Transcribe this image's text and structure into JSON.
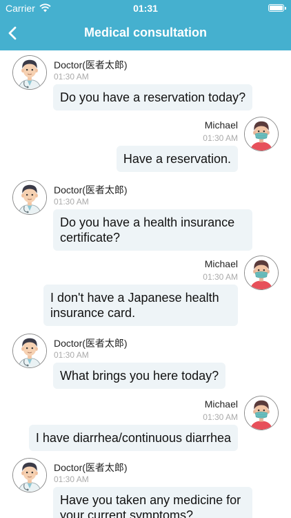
{
  "status_bar": {
    "carrier": "Carrier",
    "time": "01:31"
  },
  "nav": {
    "title": "Medical consultation"
  },
  "messages": [
    {
      "side": "left",
      "name": "Doctor(医者太郎)",
      "time": "01:30 AM",
      "text": "Do you have a reservation today?"
    },
    {
      "side": "right",
      "name": "Michael",
      "time": "01:30 AM",
      "text": "Have a reservation."
    },
    {
      "side": "left",
      "name": "Doctor(医者太郎)",
      "time": "01:30 AM",
      "text": "Do you have a health insurance certificate?"
    },
    {
      "side": "right",
      "name": "Michael",
      "time": "01:30 AM",
      "text": "I don't have a Japanese health insurance card."
    },
    {
      "side": "left",
      "name": "Doctor(医者太郎)",
      "time": "01:30 AM",
      "text": "What brings you here today?"
    },
    {
      "side": "right",
      "name": "Michael",
      "time": "01:30 AM",
      "text": "I have diarrhea/continuous diarrhea"
    },
    {
      "side": "left",
      "name": "Doctor(医者太郎)",
      "time": "01:30 AM",
      "text": "Have you taken any medicine for your current symptoms?"
    }
  ],
  "colors": {
    "header": "#45b0cf",
    "bubble": "#eef4f7",
    "mask": "#6fc0c0"
  }
}
